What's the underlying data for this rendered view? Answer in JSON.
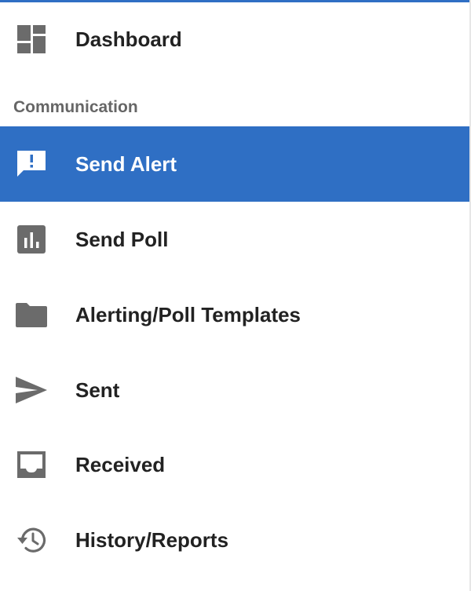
{
  "nav": {
    "dashboard": {
      "label": "Dashboard",
      "icon": "dashboard-icon"
    },
    "section_title": "Communication",
    "items": [
      {
        "label": "Send Alert",
        "icon": "alert-message-icon",
        "active": true
      },
      {
        "label": "Send Poll",
        "icon": "poll-chart-icon",
        "active": false
      },
      {
        "label": "Alerting/Poll Templates",
        "icon": "folder-icon",
        "active": false
      },
      {
        "label": "Sent",
        "icon": "send-icon",
        "active": false
      },
      {
        "label": "Received",
        "icon": "inbox-icon",
        "active": false
      },
      {
        "label": "History/Reports",
        "icon": "history-icon",
        "active": false
      }
    ]
  },
  "colors": {
    "accent": "#2f6fc4",
    "icon": "#6b6b6b",
    "text": "#222222",
    "section_text": "#666666"
  }
}
